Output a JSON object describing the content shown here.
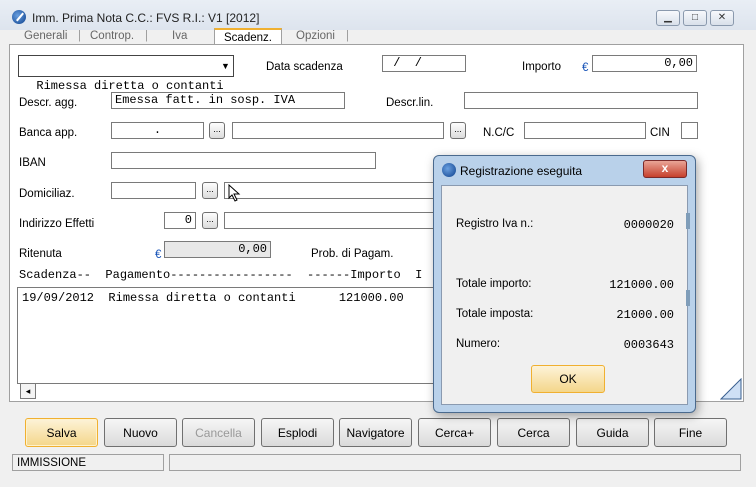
{
  "window": {
    "title": "Imm. Prima Nota C.C.: FVS  R.I.: V1  [2012]"
  },
  "tabs": [
    {
      "label": "Generali"
    },
    {
      "label": "Controp."
    },
    {
      "label": "Iva"
    },
    {
      "label": "Scadenz."
    },
    {
      "label": "Opzioni"
    }
  ],
  "form": {
    "payment_type": "Rimessa diretta o contanti",
    "data_scadenza_label": "Data scadenza",
    "data_scadenza_value": " /  /",
    "importo_label": "Importo",
    "currency": "€",
    "importo_value": "0,00",
    "descr_agg_label": "Descr. agg.",
    "descr_agg_value": "Emessa fatt. in sosp. IVA",
    "descr_lin_label": "Descr.lin.",
    "banca_label": "Banca app.",
    "banca_value": ".",
    "ncc_label": "N.C/C",
    "cin_label": "CIN",
    "iban_label": "IBAN",
    "domic_label": "Domiciliaz.",
    "indirizzo_label": "Indirizzo Effetti",
    "indirizzo_value": "0",
    "ritenuta_label": "Ritenuta",
    "ritenuta_value": "0,00",
    "prob_label": "Prob. di Pagam.",
    "dots": "..."
  },
  "grid": {
    "header": "Scadenza--  Pagamento-----------------  ------Importo  I",
    "rows": [
      "19/09/2012  Rimessa diretta o contanti      121000.00"
    ]
  },
  "buttons": {
    "salva": "Salva",
    "nuovo": "Nuovo",
    "cancella": "Cancella",
    "esplodi": "Esplodi",
    "navigatore": "Navigatore",
    "cerca_plus": "Cerca+",
    "cerca": "Cerca",
    "guida": "Guida",
    "fine": "Fine"
  },
  "status": {
    "mode": "IMMISSIONE"
  },
  "dialog": {
    "title": "Registrazione eseguita",
    "close": "x",
    "registro_label": "Registro Iva n.:",
    "registro_value": "0000020",
    "tot_importo_label": "Totale importo:",
    "tot_importo_value": "121000.00",
    "tot_imposta_label": "Totale imposta:",
    "tot_imposta_value": "21000.00",
    "numero_label": "Numero:",
    "numero_value": "0003643",
    "ok": "OK"
  }
}
